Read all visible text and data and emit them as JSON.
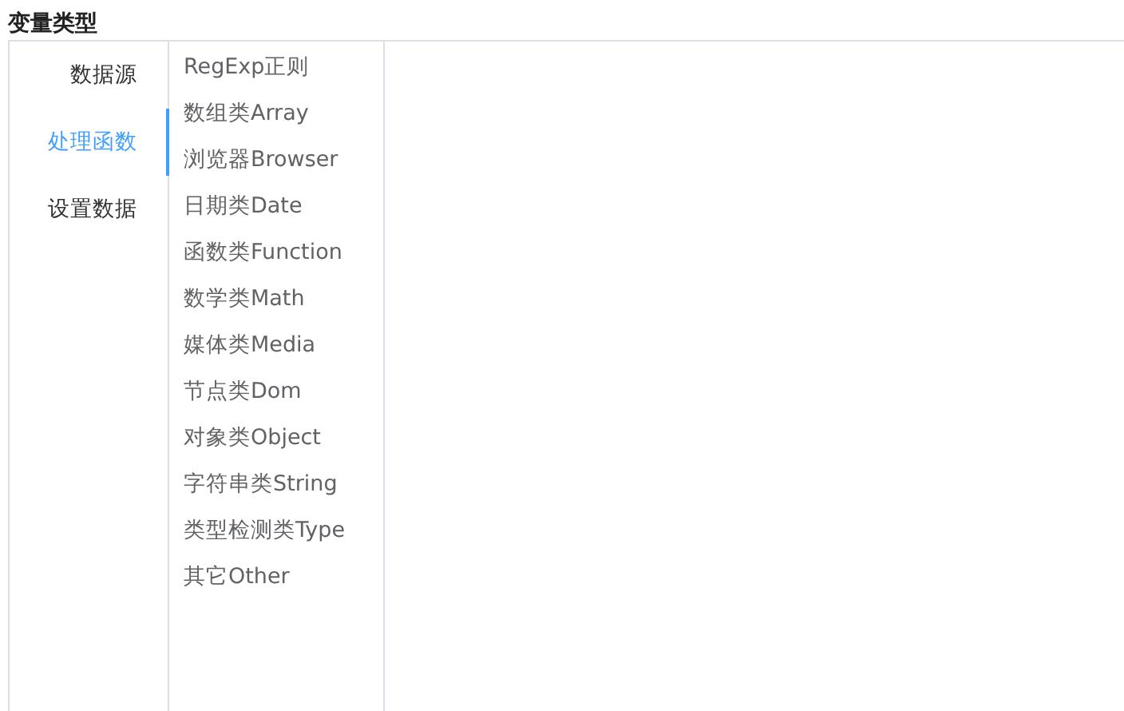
{
  "title": "变量类型",
  "tabs": [
    {
      "label": "数据源",
      "selected": false
    },
    {
      "label": "处理函数",
      "selected": true
    },
    {
      "label": "设置数据",
      "selected": false
    }
  ],
  "functions": [
    "RegExp正则",
    "数组类Array",
    "浏览器Browser",
    "日期类Date",
    "函数类Function",
    "数学类Math",
    "媒体类Media",
    "节点类Dom",
    "对象类Object",
    "字符串类String",
    "类型检测类Type",
    "其它Other"
  ]
}
